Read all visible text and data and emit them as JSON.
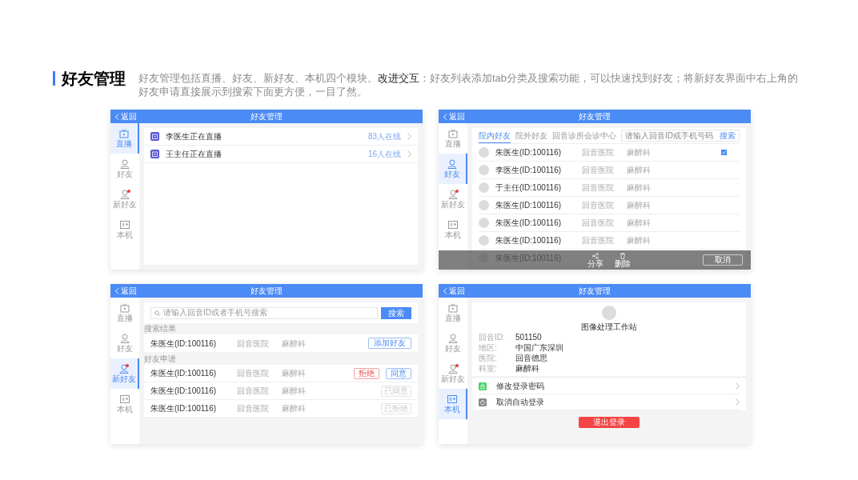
{
  "title": "好友管理",
  "description": "好友管理包括直播、好友、新好友、本机四个模块。**改进交互**：好友列表添加tab分类及搜索功能，可以快速找到好友；将新好友界面中右上角的好友申请直接展示到搜索下面更方便，一目了然。",
  "screens": [
    {
      "kind": "live",
      "header": {
        "back": "返回",
        "title": "好友管理"
      },
      "sidebar": [
        {
          "kind": "live",
          "label": "直播",
          "selected": true,
          "dot": false
        },
        {
          "kind": "friends",
          "label": "好友",
          "selected": false,
          "dot": false
        },
        {
          "kind": "new",
          "label": "新好友",
          "selected": false,
          "dot": true
        },
        {
          "kind": "device",
          "label": "本机",
          "selected": false,
          "dot": false
        }
      ],
      "items": [
        {
          "title": "李医生正在直播",
          "count": "83人在线"
        },
        {
          "title": "王主任正在直播",
          "count": "16人在线"
        }
      ]
    },
    {
      "kind": "friends",
      "header": {
        "back": "返回",
        "title": "好友管理"
      },
      "sidebar": [
        {
          "kind": "live",
          "label": "直播",
          "selected": false,
          "dot": false
        },
        {
          "kind": "friends",
          "label": "好友",
          "selected": true,
          "dot": false
        },
        {
          "kind": "new",
          "label": "新好友",
          "selected": false,
          "dot": true
        },
        {
          "kind": "device",
          "label": "本机",
          "selected": false,
          "dot": false
        }
      ],
      "tabs": [
        {
          "label": "院内好友",
          "selected": true
        },
        {
          "label": "院外好友",
          "selected": false
        },
        {
          "label": "回音诊所会诊中心",
          "selected": false
        }
      ],
      "search": {
        "placeholder": "请输入回音ID或手机号码",
        "button": "搜索"
      },
      "rows": [
        {
          "name": "朱医生(ID:100116)",
          "hospital": "回音医院",
          "department": "麻醉科",
          "checked": true
        },
        {
          "name": "李医生(ID:100116)",
          "hospital": "回音医院",
          "department": "麻醉科",
          "checked": false
        },
        {
          "name": "于主任(ID:100116)",
          "hospital": "回音医院",
          "department": "麻醉科",
          "checked": false
        },
        {
          "name": "朱医生(ID:100116)",
          "hospital": "回音医院",
          "department": "麻醉科",
          "checked": false
        },
        {
          "name": "朱医生(ID:100116)",
          "hospital": "回音医院",
          "department": "麻醉科",
          "checked": false
        },
        {
          "name": "朱医生(ID:100116)",
          "hospital": "回音医院",
          "department": "麻醉科",
          "checked": false
        },
        {
          "name": "朱医生(ID:100116)",
          "checked": false
        }
      ],
      "action_bar": {
        "actions": [
          {
            "kind": "share",
            "label": "分享"
          },
          {
            "kind": "delete",
            "label": "删除"
          }
        ],
        "cancel": "取消"
      }
    },
    {
      "kind": "new_friends",
      "header": {
        "back": "返回",
        "title": "好友管理"
      },
      "sidebar": [
        {
          "kind": "live",
          "label": "直播",
          "selected": false,
          "dot": false
        },
        {
          "kind": "friends",
          "label": "好友",
          "selected": false,
          "dot": false
        },
        {
          "kind": "new",
          "label": "新好友",
          "selected": true,
          "dot": true
        },
        {
          "kind": "device",
          "label": "本机",
          "selected": false,
          "dot": false
        }
      ],
      "search": {
        "placeholder": "请输入回音ID或者手机号搜索",
        "button": "搜索"
      },
      "result_label": "搜索结果",
      "result": {
        "name": "朱医生(ID:100116)",
        "hospital": "回音医院",
        "department": "麻醉科",
        "action": "添加好友"
      },
      "requests_label": "好友申请",
      "requests": [
        {
          "kind": "pending",
          "name": "朱医生(ID:100116)",
          "hospital": "回音医院",
          "department": "麻醉科",
          "reject": "拒绝",
          "accept": "同意"
        },
        {
          "kind": "done",
          "name": "朱医生(ID:100116)",
          "hospital": "回音医院",
          "department": "麻醉科",
          "status": "已同意"
        },
        {
          "kind": "done",
          "name": "朱医生(ID:100116)",
          "hospital": "回音医院",
          "department": "麻醉科",
          "status": "已拒绝"
        }
      ]
    },
    {
      "kind": "profile",
      "header": {
        "back": "返回",
        "title": "好友管理"
      },
      "sidebar": [
        {
          "kind": "live",
          "label": "直播",
          "selected": false,
          "dot": false
        },
        {
          "kind": "friends",
          "label": "好友",
          "selected": false,
          "dot": false
        },
        {
          "kind": "new",
          "label": "新好友",
          "selected": false,
          "dot": true
        },
        {
          "kind": "device",
          "label": "本机",
          "selected": true,
          "dot": false
        }
      ],
      "name": "图像处理工作站",
      "fields": [
        {
          "label": "回音ID:",
          "value": "501150"
        },
        {
          "label": "地区:",
          "value": "中国广东深圳"
        },
        {
          "label": "医院:",
          "value": "回音德思"
        },
        {
          "label": "科室:",
          "value": "麻醉科"
        }
      ],
      "menu": [
        {
          "kind": "password",
          "label": "修改登录密码"
        },
        {
          "kind": "autologin",
          "label": "取消自动登录"
        }
      ],
      "logout": "退出登录"
    }
  ]
}
